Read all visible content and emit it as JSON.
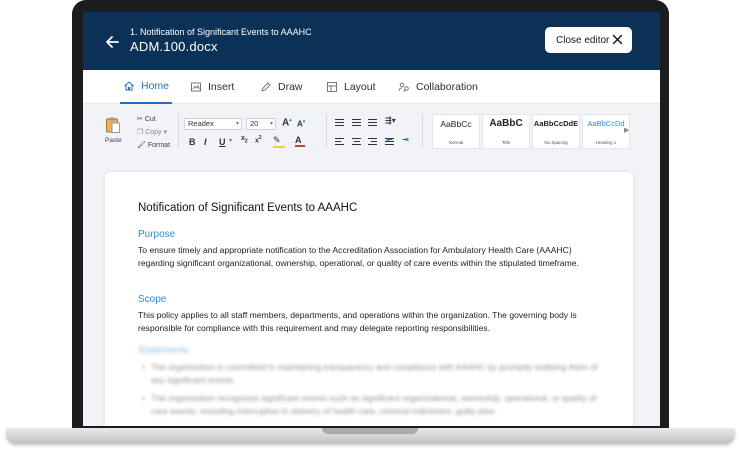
{
  "header": {
    "subtitle": "1. Notification of Significant Events to AAAHC",
    "title": "ADM.100.docx",
    "close_label": "Close editor"
  },
  "tabs": [
    {
      "label": "Home",
      "icon": "home-icon",
      "active": true
    },
    {
      "label": "Insert",
      "icon": "insert-icon",
      "active": false
    },
    {
      "label": "Draw",
      "icon": "draw-icon",
      "active": false
    },
    {
      "label": "Layout",
      "icon": "layout-icon",
      "active": false
    },
    {
      "label": "Collaboration",
      "icon": "collaboration-icon",
      "active": false
    }
  ],
  "ribbon": {
    "paste": "Paste",
    "cut": "Cut",
    "copy": "Copy",
    "format": "Format",
    "font": "Readex",
    "size": "20",
    "styles": [
      {
        "sample": "AaBbCc",
        "name": "Normal"
      },
      {
        "sample": "AaBbC",
        "name": "Title"
      },
      {
        "sample": "AaBbCcDdE",
        "name": "No Spacing"
      },
      {
        "sample": "AaBbCcDd",
        "name": "Heading 1"
      }
    ]
  },
  "document": {
    "title": "Notification of Significant Events to AAAHC",
    "purpose_heading": "Purpose",
    "purpose_text": "To ensure timely and appropriate notification to the Accreditation Association for Ambulatory Health Care (AAAHC) regarding significant organizational, ownership, operational, or quality of care events within the stipulated timeframe.",
    "scope_heading": "Scope",
    "scope_text": "This policy applies to all staff members, departments, and operations within the organization. The governing body is responsible for compliance with this requirement and may delegate reporting responsibilities.",
    "statements_heading": "Statements",
    "statements": [
      "The organization is committed to maintaining transparency and compliance with AAAHC by promptly notifying them of any significant events.",
      "The organization recognizes significant events such as significant organizational, ownership, operational, or quality of care events, including interruption in delivery of health care, criminal indictment, guilty plea"
    ]
  },
  "colors": {
    "header_bg": "#0b3157",
    "accent": "#1f6fb8",
    "section_heading": "#2e8ad8"
  }
}
